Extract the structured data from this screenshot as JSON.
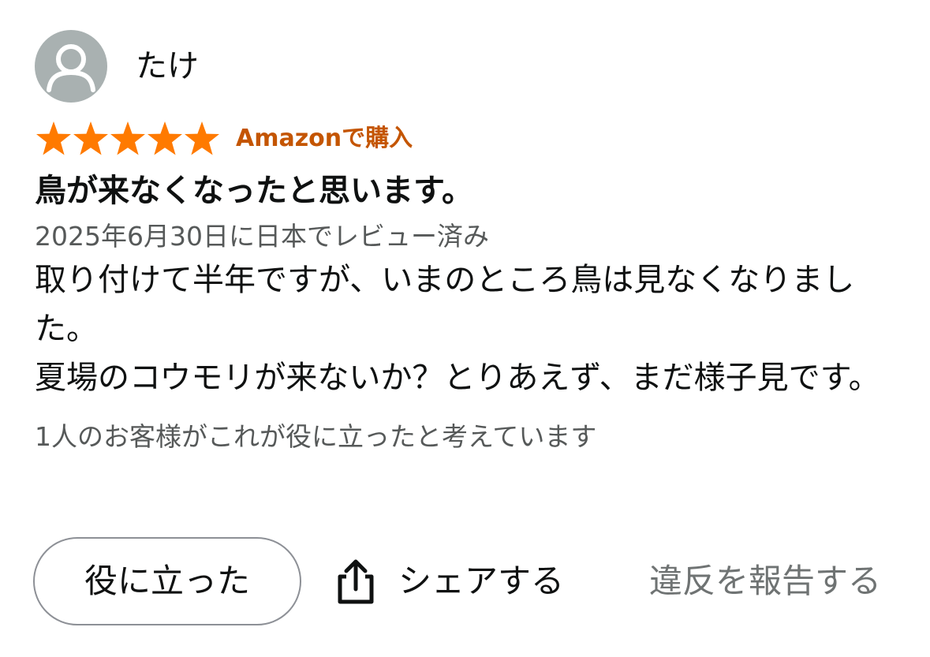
{
  "review": {
    "reviewer": {
      "name": "たけ",
      "avatar_icon": "default-user-icon"
    },
    "rating": {
      "stars": 5,
      "max": 5,
      "star_color": "#ff7a00"
    },
    "purchase_badge": "Amazonで購入",
    "title": "鳥が来なくなったと思います。",
    "date": "2025年6月30日に日本でレビュー済み",
    "body": {
      "line1": "取り付けて半年ですが、いまのところ鳥は見なくなりました。",
      "line2": "夏場のコウモリが来ないか？とりあえず、まだ様子見です。"
    },
    "helpful_count_text": "1人のお客様がこれが役に立ったと考えています"
  },
  "actions": {
    "helpful_label": "役に立った",
    "share_label": "シェアする",
    "share_icon": "share-icon",
    "report_label": "違反を報告する"
  }
}
